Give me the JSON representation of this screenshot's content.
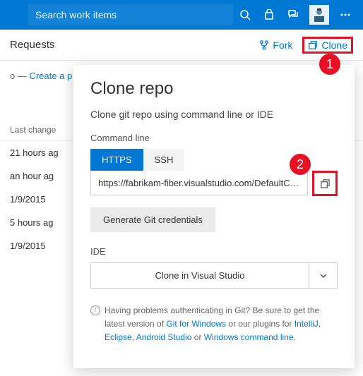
{
  "topbar": {
    "search_placeholder": "Search work items"
  },
  "subbar": {
    "title": "Requests",
    "fork_label": "Fork",
    "clone_label": "Clone"
  },
  "breadcrumb": {
    "prefix": "o — ",
    "link": "Create a p"
  },
  "bg": {
    "header": "Last change",
    "rows": [
      "21 hours ag",
      "an hour ag",
      "1/9/2015",
      "5 hours ag",
      "1/9/2015"
    ]
  },
  "badges": {
    "one": "1",
    "two": "2"
  },
  "flyout": {
    "title": "Clone repo",
    "desc": "Clone git repo using command line or IDE",
    "cmd_label": "Command line",
    "tabs": {
      "https": "HTTPS",
      "ssh": "SSH"
    },
    "url": "https://fabrikam-fiber.visualstudio.com/DefaultColl...",
    "gen_creds": "Generate Git credentials",
    "ide_label": "IDE",
    "ide_button": "Clone in Visual Studio",
    "help_text_1": "Having problems authenticating in Git? Be sure to get the latest version of ",
    "help_link_1": "Git for Windows",
    "help_text_2": " or our plugins for ",
    "help_link_2": "IntelliJ",
    "help_link_3": "Eclipse",
    "help_link_4": "Android Studio",
    "help_text_3": " or ",
    "help_link_5": "Windows command line",
    "help_text_4": "."
  }
}
